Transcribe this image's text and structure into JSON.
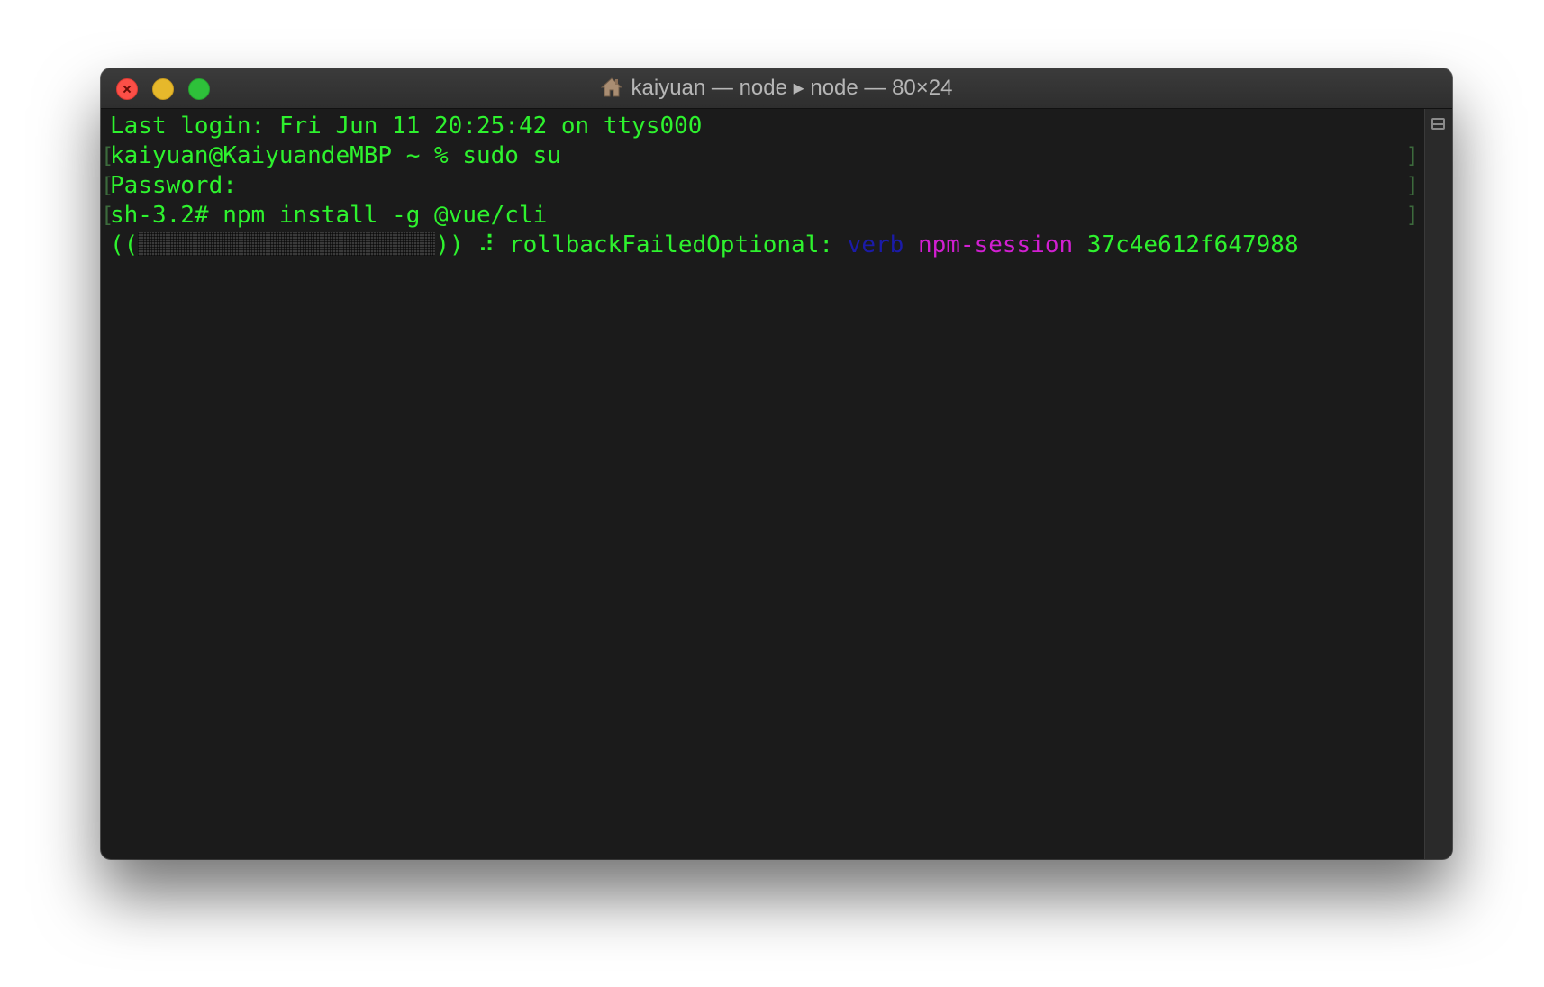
{
  "window": {
    "title": "kaiyuan — node ▸ node — 80×24",
    "icon": "home-icon"
  },
  "terminal": {
    "lines": [
      "Last login: Fri Jun 11 20:25:42 on ttys000",
      "kaiyuan@KaiyuandeMBP ~ % sudo su",
      "Password:",
      "sh-3.2# npm install -g @vue/cli"
    ],
    "progress": {
      "open": "((",
      "close": "))",
      "spinner": "⠼",
      "stage": "rollbackFailedOptional:",
      "level": "verb",
      "key": "npm-session",
      "value": "37c4e612f647988"
    },
    "colors": {
      "text": "#2ef22e",
      "level": "#1b1ba8",
      "key": "#d11fd1",
      "background": "#1b1b1b"
    }
  }
}
